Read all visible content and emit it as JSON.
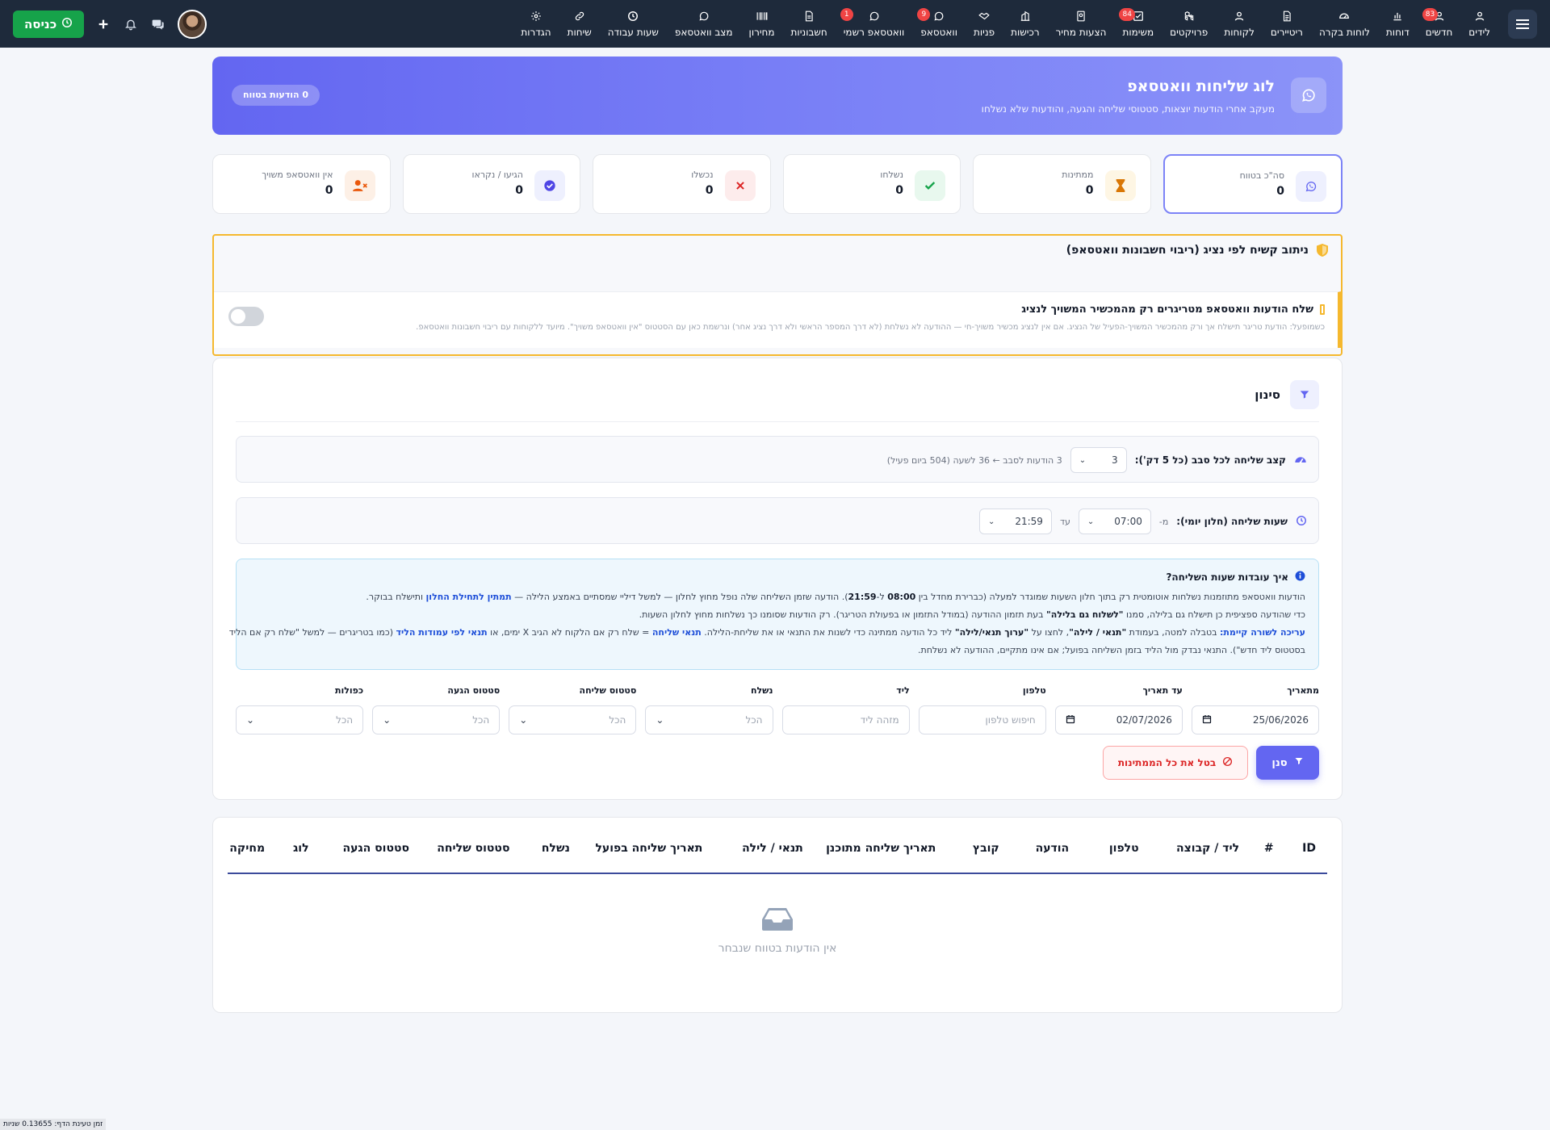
{
  "nav": {
    "items": [
      {
        "label": "לידים",
        "icon": "user-icon"
      },
      {
        "label": "חדשים",
        "icon": "user-plus-icon",
        "badge": "83"
      },
      {
        "label": "דוחות",
        "icon": "bar-chart-icon"
      },
      {
        "label": "לוחות בקרה",
        "icon": "gauge-icon"
      },
      {
        "label": "ריטיירים",
        "icon": "file-lines-icon"
      },
      {
        "label": "לקוחות",
        "icon": "user-icon"
      },
      {
        "label": "פרויקטים",
        "icon": "cubes-icon"
      },
      {
        "label": "משימות",
        "icon": "checkbox-icon",
        "badge": "84"
      },
      {
        "label": "הצעות מחיר",
        "icon": "document-icon"
      },
      {
        "label": "רכישות",
        "icon": "building-icon"
      },
      {
        "label": "פניות",
        "icon": "handshake-icon"
      },
      {
        "label": "וואטסאפ",
        "icon": "whatsapp-icon",
        "badge": "9"
      },
      {
        "label": "וואטסאפ רשמי",
        "icon": "whatsapp-icon",
        "badge": "1"
      },
      {
        "label": "חשבוניות",
        "icon": "invoice-icon"
      },
      {
        "label": "מחירון",
        "icon": "barcode-icon"
      },
      {
        "label": "מצב וואטסאפ",
        "icon": "whatsapp-icon"
      },
      {
        "label": "שעות עבודה",
        "icon": "clock-icon"
      },
      {
        "label": "שיחות",
        "icon": "link-icon"
      },
      {
        "label": "הגדרות",
        "icon": "gear-icon"
      }
    ],
    "checkin_label": "כניסה"
  },
  "banner": {
    "title": "לוג שליחות וואטסאפ",
    "subtitle": "מעקב אחרי הודעות יוצאות, סטטוסי שליחה והגעה, והודעות שלא נשלחו",
    "pill": "0 הודעות בטווח"
  },
  "stats": [
    {
      "label": "סה\"כ בטווח",
      "value": "0",
      "icon": "whatsapp-icon",
      "color": "#6366f1",
      "bg": "#eef0fe",
      "active": true
    },
    {
      "label": "ממתינות",
      "value": "0",
      "icon": "hourglass-icon",
      "color": "#d97706",
      "bg": "#fef6e4"
    },
    {
      "label": "נשלחו",
      "value": "0",
      "icon": "check-icon",
      "color": "#16a34a",
      "bg": "#e8f8ee"
    },
    {
      "label": "נכשלו",
      "value": "0",
      "icon": "x-icon",
      "color": "#dc2626",
      "bg": "#fdecec"
    },
    {
      "label": "הגיעו / נקראו",
      "value": "0",
      "icon": "check-circle-icon",
      "color": "#4f46e5",
      "bg": "#eef0fe"
    },
    {
      "label": "אין וואטסאפ משויך",
      "value": "0",
      "icon": "user-x-icon",
      "color": "#ea580c",
      "bg": "#fdf0e6"
    }
  ],
  "routing": {
    "title": "ניתוב קשיח לפי נציג (ריבוי חשבונות וואטסאפ)",
    "toggle_title": "שלח הודעות וואטסאפ מטריגרים רק מהמכשיר המשויך לנציג",
    "toggle_desc": "כשמופעל: הודעת טריגר תישלח אך ורק מהמכשיר המשויך-הפעיל של הנציג. אם אין לנציג מכשיר משויך-חי — ההודעה לא נשלחת (לא דרך המספר הראשי ולא דרך נציג אחר) ונרשמת כאן עם הסטטוס \"אין וואטסאפ משויך\". מיועד ללקוחות עם ריבוי חשבונות וואטסאפ.",
    "toggle_on": false
  },
  "filters": {
    "title": "סינון",
    "rate": {
      "label": "קצב שליחה לכל סבב (כל 5 דק'):",
      "value": "3",
      "note": "3 הודעות לסבב ← 36 לשעה (504 ביום פעיל)"
    },
    "hours": {
      "label": "שעות שליחה (חלון יומי):",
      "from_label": "מ-",
      "from": "07:00",
      "to_label": "עד",
      "to": "21:59"
    },
    "info": {
      "title": "איך עובדות שעות השליחה?",
      "l1a": "הודעות וואטסאפ מתוזמנות נשלחות אוטומטית רק בתוך חלון השעות שמוגדר למעלה (כברירת מחדל בין ",
      "l1b": "08:00",
      "l1c": " ל-",
      "l1d": "21:59",
      "l1e": "). הודעה שזמן השליחה שלה נופל מחוץ לחלון — למשל דיליי שמסתיים באמצע הלילה — ",
      "l1f": "תמתין לתחילת החלון",
      "l1g": " ותישלח בבוקר.",
      "l2a": "כדי שהודעה ספציפית כן תישלח גם בלילה, סמנו ",
      "l2b": "\"לשלוח גם בלילה\"",
      "l2c": " בעת תזמון ההודעה (במודל התזמון או בפעולת הטריגר). רק הודעות שסומנו כך נשלחות מחוץ לחלון השעות.",
      "l3a": "עריכה לשורה קיימת:",
      "l3b": " בטבלה למטה, בעמודת ",
      "l3c": "\"תנאי / לילה\"",
      "l3d": ", לחצו על ",
      "l3e": "\"ערוך תנאי/לילה\"",
      "l3f": " ליד כל הודעה ממתינה כדי לשנות את התנאי או את שליחת-הלילה. ",
      "l3g": "תנאי שליחה",
      "l3h": " = שלח רק אם הלקוח לא הגיב X ימים, או ",
      "l3i": "תנאי לפי עמודות הליד",
      "l3j": " (כמו בטריגרים — למשל \"שלח רק אם הליד",
      "l4": "בסטטוס ליד חדש\"). התנאי נבדק מול הליד בזמן השליחה בפועל; אם אינו מתקיים, ההודעה לא נשלחת."
    },
    "fields": [
      {
        "label": "מתאריך",
        "value": "25/06/2026",
        "kind": "date"
      },
      {
        "label": "עד תאריך",
        "value": "02/07/2026",
        "kind": "date"
      },
      {
        "label": "טלפון",
        "placeholder": "חיפוש טלפון",
        "kind": "text"
      },
      {
        "label": "ליד",
        "placeholder": "מזהה ליד",
        "kind": "text"
      },
      {
        "label": "נשלח",
        "placeholder": "הכל",
        "kind": "select"
      },
      {
        "label": "סטטוס שליחה",
        "placeholder": "הכל",
        "kind": "select"
      },
      {
        "label": "סטטוס הגעה",
        "placeholder": "הכל",
        "kind": "select"
      },
      {
        "label": "כפולות",
        "placeholder": "הכל",
        "kind": "select"
      }
    ],
    "filter_btn": "סנן",
    "cancel_btn": "בטל את כל הממתינות"
  },
  "table": {
    "columns": [
      "ID",
      "#",
      "ליד / קבוצה",
      "טלפון",
      "הודעה",
      "קובץ",
      "תאריך שליחה מתוכנן",
      "תנאי / לילה",
      "תאריך שליחה בפועל",
      "נשלח",
      "סטטוס שליחה",
      "סטטוס הגעה",
      "לוג",
      "מחיקה"
    ],
    "empty_text": "אין הודעות בטווח שנבחר"
  },
  "footer": "זמן טעינת הדף: 0.13655 שניות"
}
